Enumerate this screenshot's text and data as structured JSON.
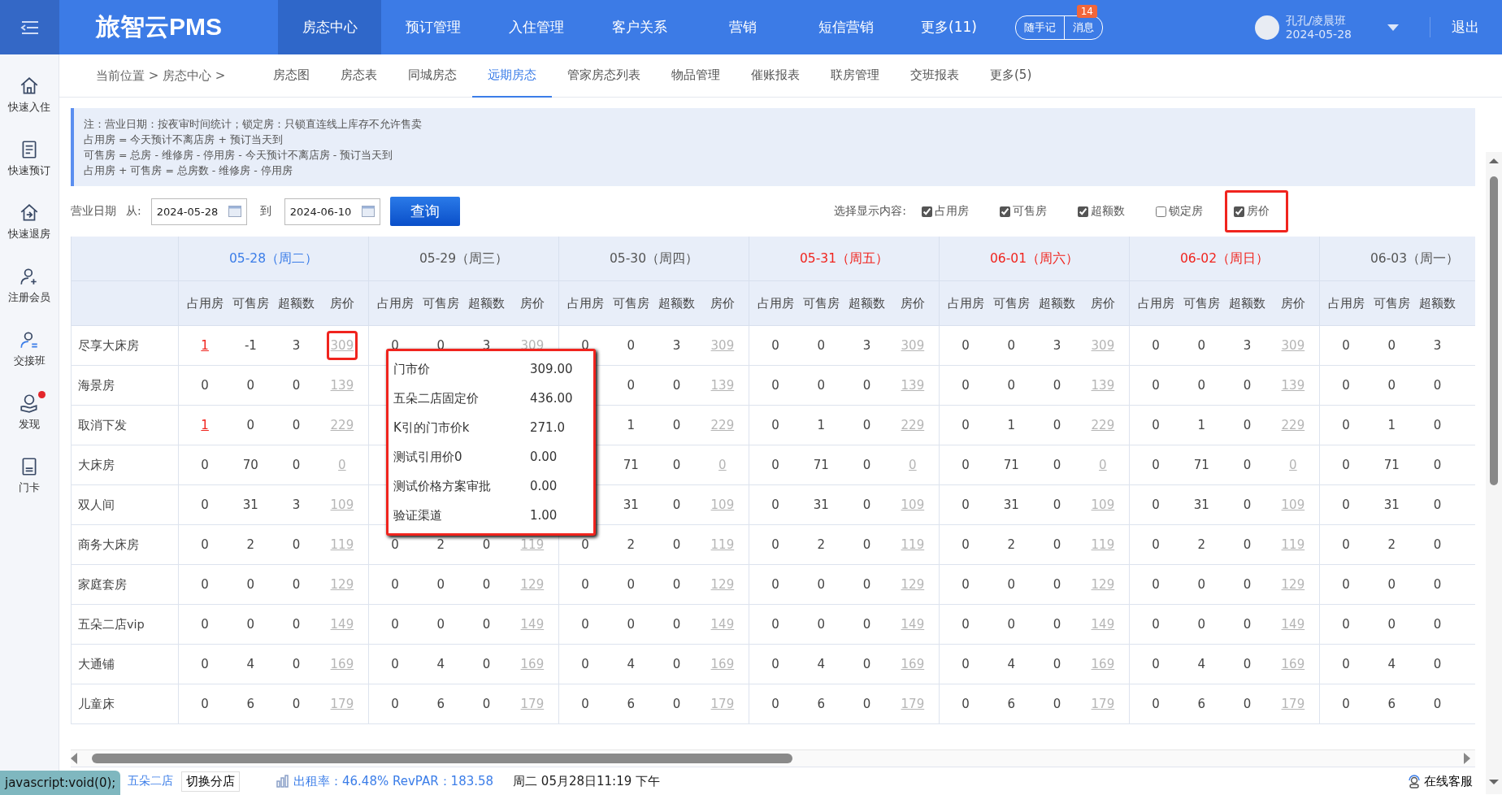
{
  "topbar": {
    "logo": "旅智云PMS",
    "nav": [
      {
        "label": "房态中心",
        "selected": true
      },
      {
        "label": "预订管理",
        "selected": false
      },
      {
        "label": "入住管理",
        "selected": false
      },
      {
        "label": "客户关系",
        "selected": false
      },
      {
        "label": "营销",
        "selected": false
      },
      {
        "label": "短信营销",
        "selected": false
      },
      {
        "label": "更多(11)",
        "selected": false
      }
    ],
    "pill_buttons": [
      "随手记",
      "消息"
    ],
    "message_badge": "14",
    "user": {
      "name": "孔孔/凌晨班",
      "date": "2024-05-28"
    },
    "logout": "退出"
  },
  "sidebar": {
    "items": [
      {
        "label": "快速入住",
        "dot": false
      },
      {
        "label": "快速预订",
        "dot": false
      },
      {
        "label": "快速退房",
        "dot": false
      },
      {
        "label": "注册会员",
        "dot": false
      },
      {
        "label": "交接班",
        "dot": false
      },
      {
        "label": "发现",
        "dot": true
      },
      {
        "label": "门卡",
        "dot": false
      }
    ]
  },
  "subnav": {
    "breadcrumb": "当前位置 > 房态中心 >",
    "tabs": [
      {
        "label": "房态图",
        "selected": false
      },
      {
        "label": "房态表",
        "selected": false
      },
      {
        "label": "同城房态",
        "selected": false
      },
      {
        "label": "远期房态",
        "selected": true
      },
      {
        "label": "管家房态列表",
        "selected": false
      },
      {
        "label": "物品管理",
        "selected": false
      },
      {
        "label": "催账报表",
        "selected": false
      },
      {
        "label": "联房管理",
        "selected": false
      },
      {
        "label": "交班报表",
        "selected": false
      },
      {
        "label": "更多(5)",
        "selected": false
      }
    ]
  },
  "notes": [
    "注：营业日期：按夜审时间统计；锁定房：只锁直连线上库存不允许售卖",
    "占用房 = 今天预计不离店房 + 预订当天到",
    "可售房 = 总房 - 维修房 - 停用房 - 今天预计不离店房 - 预订当天到",
    "占用房 + 可售房 = 总房数 - 维修房 - 停用房"
  ],
  "filter": {
    "label": "营业日期",
    "from_label": "从:",
    "from": "2024-05-28",
    "to_label": "到",
    "to": "2024-06-10",
    "query": "查询",
    "display_label": "选择显示内容:",
    "options": [
      {
        "label": "占用房",
        "checked": true,
        "outlined": false
      },
      {
        "label": "可售房",
        "checked": true,
        "outlined": false
      },
      {
        "label": "超额数",
        "checked": true,
        "outlined": false
      },
      {
        "label": "锁定房",
        "checked": false,
        "outlined": false
      },
      {
        "label": "房价",
        "checked": true,
        "outlined": true
      }
    ]
  },
  "table": {
    "days": [
      {
        "label": "05-28（周二）",
        "kind": "today",
        "columns": [
          "占用房",
          "可售房",
          "超额数",
          "房价"
        ]
      },
      {
        "label": "05-29（周三）",
        "kind": "normal",
        "columns": [
          "占用房",
          "可售房",
          "超额数",
          "房价"
        ]
      },
      {
        "label": "05-30（周四）",
        "kind": "normal",
        "columns": [
          "占用房",
          "可售房",
          "超额数",
          "房价"
        ]
      },
      {
        "label": "05-31（周五）",
        "kind": "weekend",
        "columns": [
          "占用房",
          "可售房",
          "超额数",
          "房价"
        ]
      },
      {
        "label": "06-01（周六）",
        "kind": "weekend",
        "columns": [
          "占用房",
          "可售房",
          "超额数",
          "房价"
        ]
      },
      {
        "label": "06-02（周日）",
        "kind": "weekend",
        "columns": [
          "占用房",
          "可售房",
          "超额数",
          "房价"
        ]
      },
      {
        "label": "06-03（周一）",
        "kind": "normal",
        "columns": [
          "占用房",
          "可售房",
          "超额数"
        ]
      }
    ],
    "rows": [
      {
        "name": "尽享大床房",
        "cells": [
          {
            "occupied": "1",
            "available": "-1",
            "over": "3",
            "price": "309",
            "occupied_link": true,
            "price_outlined": true
          },
          {
            "occupied": "0",
            "available": "0",
            "over": "3",
            "price": "309"
          },
          {
            "occupied": "0",
            "available": "0",
            "over": "3",
            "price": "309"
          },
          {
            "occupied": "0",
            "available": "0",
            "over": "3",
            "price": "309"
          },
          {
            "occupied": "0",
            "available": "0",
            "over": "3",
            "price": "309"
          },
          {
            "occupied": "0",
            "available": "0",
            "over": "3",
            "price": "309"
          },
          {
            "occupied": "0",
            "available": "0",
            "over": "3"
          }
        ]
      },
      {
        "name": "海景房",
        "cells": [
          {
            "occupied": "0",
            "available": "0",
            "over": "0",
            "price": "139"
          },
          {},
          {
            "available": "0",
            "over": "0",
            "price": "139"
          },
          {
            "occupied": "0",
            "available": "0",
            "over": "0",
            "price": "139"
          },
          {
            "occupied": "0",
            "available": "0",
            "over": "0",
            "price": "139"
          },
          {
            "occupied": "0",
            "available": "0",
            "over": "0",
            "price": "139"
          },
          {
            "occupied": "0",
            "available": "0",
            "over": "0"
          }
        ]
      },
      {
        "name": "取消下发",
        "cells": [
          {
            "occupied": "1",
            "available": "0",
            "over": "0",
            "price": "229",
            "occupied_link": true
          },
          {},
          {
            "available": "1",
            "over": "0",
            "price": "229"
          },
          {
            "occupied": "0",
            "available": "1",
            "over": "0",
            "price": "229"
          },
          {
            "occupied": "0",
            "available": "1",
            "over": "0",
            "price": "229"
          },
          {
            "occupied": "0",
            "available": "1",
            "over": "0",
            "price": "229"
          },
          {
            "occupied": "0",
            "available": "1",
            "over": "0"
          }
        ]
      },
      {
        "name": "大床房",
        "cells": [
          {
            "occupied": "0",
            "available": "70",
            "over": "0",
            "price": "0"
          },
          {},
          {
            "available": "71",
            "over": "0",
            "price": "0"
          },
          {
            "occupied": "0",
            "available": "71",
            "over": "0",
            "price": "0"
          },
          {
            "occupied": "0",
            "available": "71",
            "over": "0",
            "price": "0"
          },
          {
            "occupied": "0",
            "available": "71",
            "over": "0",
            "price": "0"
          },
          {
            "occupied": "0",
            "available": "71",
            "over": "0"
          }
        ]
      },
      {
        "name": "双人间",
        "cells": [
          {
            "occupied": "0",
            "available": "31",
            "over": "3",
            "price": "109"
          },
          {},
          {
            "available": "31",
            "over": "0",
            "price": "109"
          },
          {
            "occupied": "0",
            "available": "31",
            "over": "0",
            "price": "109"
          },
          {
            "occupied": "0",
            "available": "31",
            "over": "0",
            "price": "109"
          },
          {
            "occupied": "0",
            "available": "31",
            "over": "0",
            "price": "109"
          },
          {
            "occupied": "0",
            "available": "31",
            "over": "0"
          }
        ]
      },
      {
        "name": "商务大床房",
        "cells": [
          {
            "occupied": "0",
            "available": "2",
            "over": "0",
            "price": "119"
          },
          {
            "occupied": "0",
            "available": "2",
            "over": "0",
            "price": "119"
          },
          {
            "occupied": "0",
            "available": "2",
            "over": "0",
            "price": "119"
          },
          {
            "occupied": "0",
            "available": "2",
            "over": "0",
            "price": "119"
          },
          {
            "occupied": "0",
            "available": "2",
            "over": "0",
            "price": "119"
          },
          {
            "occupied": "0",
            "available": "2",
            "over": "0",
            "price": "119"
          },
          {
            "occupied": "0",
            "available": "2",
            "over": "0"
          }
        ]
      },
      {
        "name": "家庭套房",
        "cells": [
          {
            "occupied": "0",
            "available": "0",
            "over": "0",
            "price": "129"
          },
          {
            "occupied": "0",
            "available": "0",
            "over": "0",
            "price": "129"
          },
          {
            "occupied": "0",
            "available": "0",
            "over": "0",
            "price": "129"
          },
          {
            "occupied": "0",
            "available": "0",
            "over": "0",
            "price": "129"
          },
          {
            "occupied": "0",
            "available": "0",
            "over": "0",
            "price": "129"
          },
          {
            "occupied": "0",
            "available": "0",
            "over": "0",
            "price": "129"
          },
          {
            "occupied": "0",
            "available": "0",
            "over": "0"
          }
        ]
      },
      {
        "name": "五朵二店vip",
        "cells": [
          {
            "occupied": "0",
            "available": "0",
            "over": "0",
            "price": "149"
          },
          {
            "occupied": "0",
            "available": "0",
            "over": "0",
            "price": "149"
          },
          {
            "occupied": "0",
            "available": "0",
            "over": "0",
            "price": "149"
          },
          {
            "occupied": "0",
            "available": "0",
            "over": "0",
            "price": "149"
          },
          {
            "occupied": "0",
            "available": "0",
            "over": "0",
            "price": "149"
          },
          {
            "occupied": "0",
            "available": "0",
            "over": "0",
            "price": "149"
          },
          {
            "occupied": "0",
            "available": "0",
            "over": "0"
          }
        ]
      },
      {
        "name": "大通铺",
        "cells": [
          {
            "occupied": "0",
            "available": "4",
            "over": "0",
            "price": "169"
          },
          {
            "occupied": "0",
            "available": "4",
            "over": "0",
            "price": "169"
          },
          {
            "occupied": "0",
            "available": "4",
            "over": "0",
            "price": "169"
          },
          {
            "occupied": "0",
            "available": "4",
            "over": "0",
            "price": "169"
          },
          {
            "occupied": "0",
            "available": "4",
            "over": "0",
            "price": "169"
          },
          {
            "occupied": "0",
            "available": "4",
            "over": "0",
            "price": "169"
          },
          {
            "occupied": "0",
            "available": "4",
            "over": "0"
          }
        ]
      },
      {
        "name": "儿童床",
        "cells": [
          {
            "occupied": "0",
            "available": "6",
            "over": "0",
            "price": "179"
          },
          {
            "occupied": "0",
            "available": "6",
            "over": "0",
            "price": "179"
          },
          {
            "occupied": "0",
            "available": "6",
            "over": "0",
            "price": "179"
          },
          {
            "occupied": "0",
            "available": "6",
            "over": "0",
            "price": "179"
          },
          {
            "occupied": "0",
            "available": "6",
            "over": "0",
            "price": "179"
          },
          {
            "occupied": "0",
            "available": "6",
            "over": "0",
            "price": "179"
          },
          {
            "occupied": "0",
            "available": "6",
            "over": "0"
          }
        ]
      }
    ]
  },
  "price_popup": [
    {
      "label": "门市价",
      "value": "309.00"
    },
    {
      "label": "五朵二店固定价",
      "value": "436.00"
    },
    {
      "label": "K引的门市价k",
      "value": "271.0"
    },
    {
      "label": "测试引用价0",
      "value": "0.00"
    },
    {
      "label": "测试价格方案审批",
      "value": "0.00"
    },
    {
      "label": "验证渠道",
      "value": "1.00"
    }
  ],
  "status_bar": {
    "link_preview": "javascript:void(0);",
    "store": "五朵二店",
    "switch_store": "切换分店",
    "occupancy": "出租率：46.48% RevPAR：183.58",
    "datetime": "周二 05月28日11:19 下午",
    "support": "在线客服"
  }
}
